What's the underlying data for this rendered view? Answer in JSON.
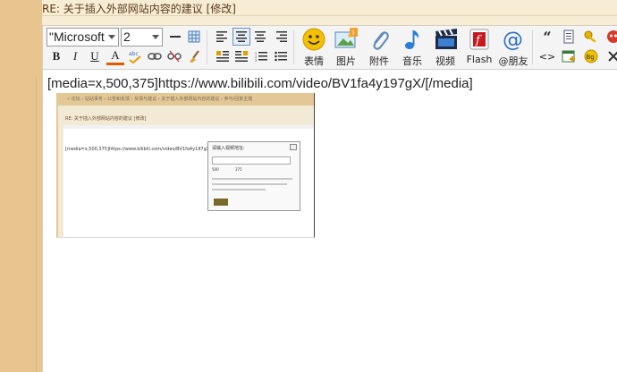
{
  "title": "RE: 关于插入外部网站内容的建议 [修改]",
  "toolbar": {
    "font_family": "\"Microsoft",
    "font_size": "2",
    "bold": "B",
    "italic": "I",
    "underline": "U",
    "font_color": "A",
    "big_buttons": [
      {
        "label": "表情",
        "icon": "smiley-icon"
      },
      {
        "label": "图片",
        "icon": "image-icon"
      },
      {
        "label": "附件",
        "icon": "paperclip-icon"
      },
      {
        "label": "音乐",
        "icon": "music-note-icon"
      },
      {
        "label": "视频",
        "icon": "video-clapper-icon"
      },
      {
        "label": "Flash",
        "icon": "flash-icon"
      },
      {
        "label": "@朋友",
        "icon": "at-sign-icon"
      }
    ],
    "quote_glyph": "“",
    "code_glyph": "<>"
  },
  "content": {
    "text": "[media=x,500,375]https://www.bilibili.com/video/BV1fa4y197gX/[/media]"
  },
  "embedded_screenshot": {
    "breadcrumb": "« 论坛 › 站站事务 › 公告和反馈 › 反馈与建议 › 关于插入外部网站内容的建议 › 参与/回复主题",
    "title": "RE: 关于插入外部网站内容的建议 [修改]",
    "text": "[media=x,500,375]https://www.bilibili.com/video/BV1fa4y197gX/",
    "dialog_title": "请输入视频地址:",
    "dialog_width": "500",
    "dialog_height": "375"
  },
  "colors": {
    "left_strip": "#e8c48f",
    "frame_bg": "#f7ecd4",
    "toolbar_bg": "#f4f4f4",
    "active_border": "#6f8fb5"
  }
}
